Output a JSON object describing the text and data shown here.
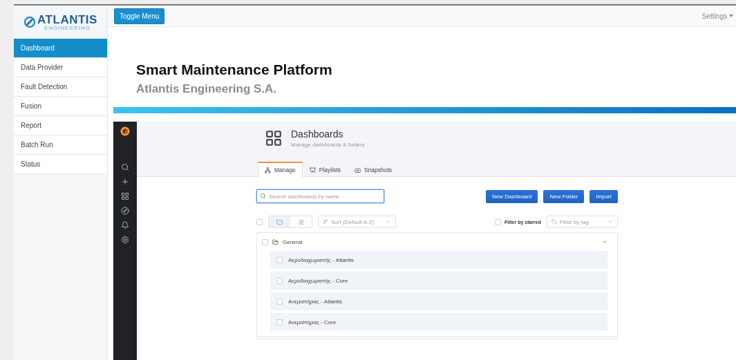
{
  "logo": {
    "name": "ATLANTIS",
    "tagline": "ENGINEERING"
  },
  "sidebar": {
    "items": [
      {
        "label": "Dashboard",
        "selected": true
      },
      {
        "label": "Data Provider",
        "selected": false
      },
      {
        "label": "Fault Detection",
        "selected": false
      },
      {
        "label": "Fusion",
        "selected": false
      },
      {
        "label": "Report",
        "selected": false
      },
      {
        "label": "Batch Run",
        "selected": false
      },
      {
        "label": "Status",
        "selected": false
      }
    ]
  },
  "topbar": {
    "toggle_button": "Toggle Menu",
    "settings": "Settings"
  },
  "hero": {
    "title": "Smart Maintenance Platform",
    "subtitle": "Atlantis Engineering S.A."
  },
  "grafana": {
    "page_title": "Dashboards",
    "page_subtitle": "Manage dashboards & folders",
    "tabs": [
      {
        "label": "Manage",
        "selected": true
      },
      {
        "label": "Playlists",
        "selected": false
      },
      {
        "label": "Snapshots",
        "selected": false
      }
    ],
    "search": {
      "placeholder": "Search dashboards by name"
    },
    "buttons": [
      "New Dashboard",
      "New Folder",
      "Import"
    ],
    "view_modes": [
      {
        "kind": "folder",
        "selected": true
      },
      {
        "kind": "list",
        "selected": false
      }
    ],
    "select_all": {
      "checked": false
    },
    "sort": {
      "placeholder": "Sort (Default A-Z)"
    },
    "filter_starred": {
      "label": "Filter by starred",
      "checked": false
    },
    "filter_tag": {
      "placeholder": "Filter by tag"
    },
    "folders": [
      {
        "name": "General",
        "checked": false,
        "expanded": true,
        "dashboards": [
          {
            "name": "Αεροδιαχωριστής - Atlantis",
            "checked": false
          },
          {
            "name": "Αεροδιαχωριστής - Core",
            "checked": false
          },
          {
            "name": "Ανεμιστήρας - Atlantis",
            "checked": false
          },
          {
            "name": "Ανεμιστήρας - Core",
            "checked": false
          }
        ]
      }
    ]
  }
}
